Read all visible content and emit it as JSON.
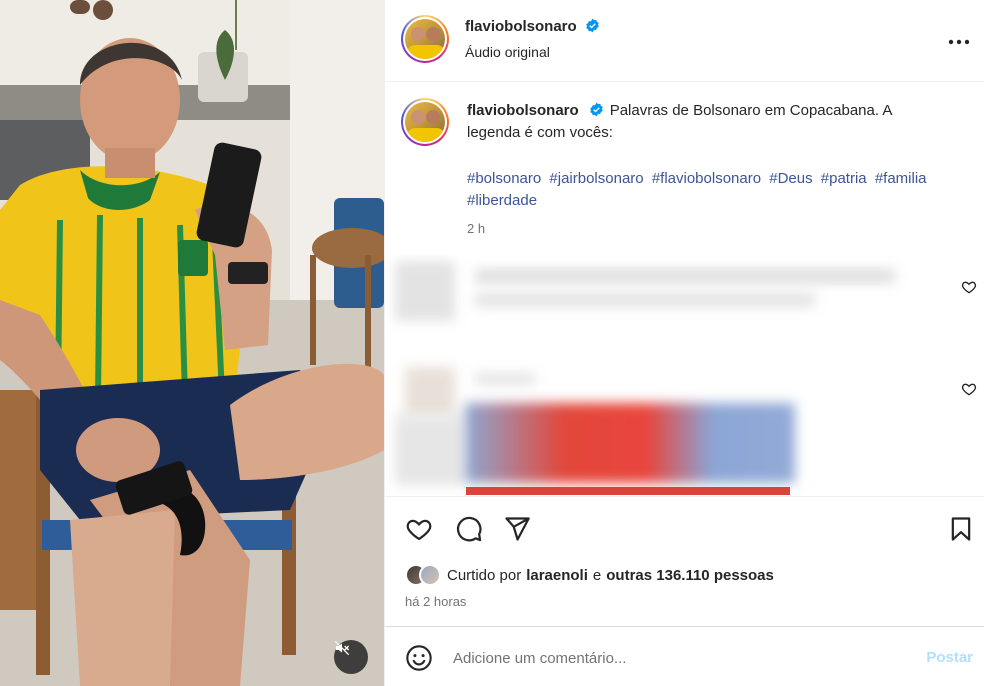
{
  "post": {
    "author": "flaviobolsonaro",
    "audio_label": "Áudio original",
    "caption": "Palavras de Bolsonaro em Copacabana. A legenda é com vocês:",
    "hashtags": [
      "#bolsonaro",
      "#jairbolsonaro",
      "#flaviobolsonaro",
      "#Deus",
      "#patria",
      "#familia",
      "#liberdade"
    ],
    "caption_time": "2 h",
    "liked_by_prefix": "Curtido por",
    "liked_by_user": "laraenoli",
    "liked_by_connector": "e",
    "liked_by_others": "outras 136.110 pessoas",
    "posted_ago": "há 2 horas"
  },
  "comment_box": {
    "placeholder": "Adicione um comentário...",
    "post_label": "Postar"
  },
  "colors": {
    "hashtag": "#3b5598",
    "verified": "#0095f6",
    "post_disabled": "#b2dffc",
    "muted_text": "#737373"
  },
  "icons": [
    "verified-badge-icon",
    "more-options-icon",
    "heart-icon",
    "comment-icon",
    "share-icon",
    "bookmark-icon",
    "emoji-icon",
    "muted-speaker-icon"
  ]
}
